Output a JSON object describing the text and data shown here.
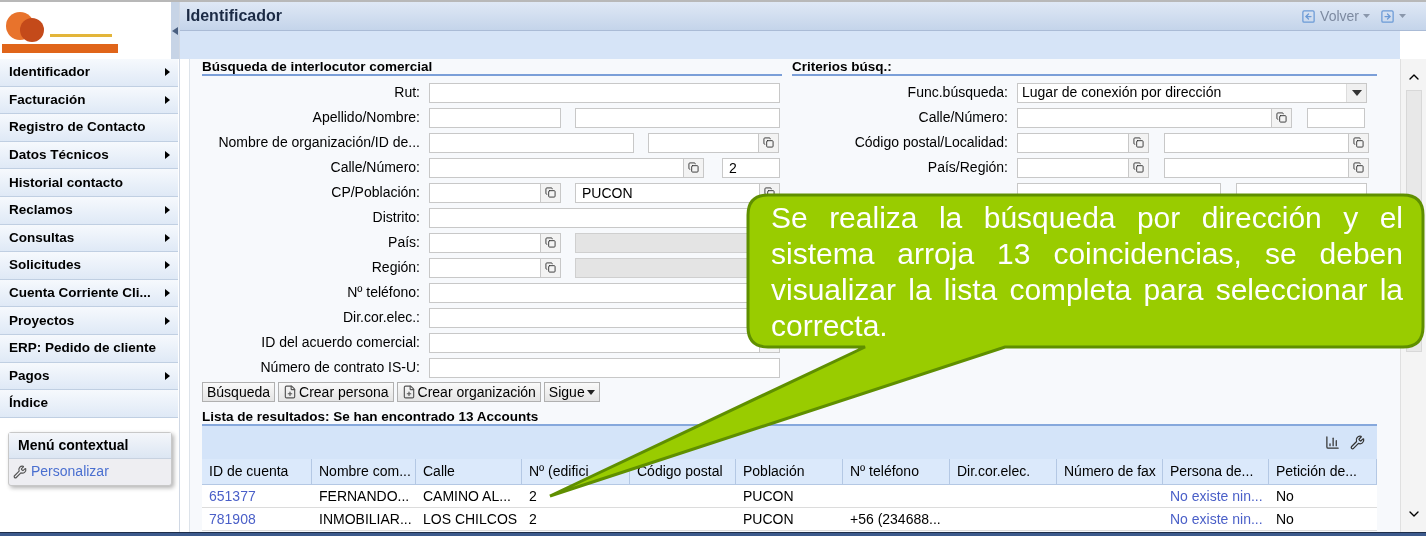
{
  "sidebar": {
    "items": [
      {
        "label": "Identificador",
        "has_submenu": true
      },
      {
        "label": "Facturación",
        "has_submenu": true
      },
      {
        "label": "Registro de Contacto",
        "has_submenu": false
      },
      {
        "label": "Datos Técnicos",
        "has_submenu": true
      },
      {
        "label": "Historial contacto",
        "has_submenu": false
      },
      {
        "label": "Reclamos",
        "has_submenu": true
      },
      {
        "label": "Consultas",
        "has_submenu": true
      },
      {
        "label": "Solicitudes",
        "has_submenu": true
      },
      {
        "label": "Cuenta Corriente Cli...",
        "has_submenu": true
      },
      {
        "label": "Proyectos",
        "has_submenu": true
      },
      {
        "label": "ERP: Pedido de cliente",
        "has_submenu": false
      },
      {
        "label": "Pagos",
        "has_submenu": true
      },
      {
        "label": "Índice",
        "has_submenu": false
      }
    ],
    "context_menu": {
      "title": "Menú contextual",
      "items": [
        {
          "label": "Personalizar"
        }
      ]
    }
  },
  "header": {
    "title": "Identificador",
    "back": {
      "label": "Volver",
      "disabled": true
    }
  },
  "search_form": {
    "title": "Búsqueda de interlocutor comercial",
    "fields": [
      {
        "label": "Rut:",
        "kind": "full",
        "inputs": [
          {
            "lookup": false,
            "disabled": false
          }
        ]
      },
      {
        "label": "Apellido/Nombre:",
        "kind": "pair",
        "inputs": [
          {
            "lookup": false,
            "disabled": false
          },
          {
            "lookup": false,
            "disabled": false
          }
        ]
      },
      {
        "label": "Nombre de organización/ID de...",
        "kind": "name_id",
        "inputs": [
          {
            "lookup": false,
            "disabled": false
          },
          {
            "lookup": true,
            "disabled": false
          }
        ]
      },
      {
        "label": "Calle/Número:",
        "kind": "street",
        "inputs": [
          {
            "lookup": true,
            "disabled": false
          },
          {
            "value": "2",
            "lookup": false,
            "disabled": false
          }
        ]
      },
      {
        "label": "CP/Población:",
        "kind": "pair",
        "inputs": [
          {
            "lookup": true,
            "disabled": false
          },
          {
            "value": "PUCON",
            "lookup": true,
            "disabled": false
          }
        ]
      },
      {
        "label": "Distrito:",
        "kind": "full",
        "inputs": [
          {
            "lookup": false,
            "disabled": false
          }
        ]
      },
      {
        "label": "País:",
        "kind": "pair",
        "inputs": [
          {
            "lookup": true,
            "disabled": false
          },
          {
            "lookup": false,
            "disabled": true
          }
        ]
      },
      {
        "label": "Región:",
        "kind": "pair",
        "inputs": [
          {
            "lookup": true,
            "disabled": false
          },
          {
            "lookup": false,
            "disabled": true
          }
        ]
      },
      {
        "label": "Nº teléfono:",
        "kind": "full",
        "inputs": [
          {
            "lookup": false,
            "disabled": false
          }
        ]
      },
      {
        "label": "Dir.cor.elec.:",
        "kind": "full",
        "inputs": [
          {
            "lookup": false,
            "disabled": false
          }
        ]
      },
      {
        "label": "ID del acuerdo comercial:",
        "kind": "full",
        "inputs": [
          {
            "lookup": true,
            "disabled": false
          }
        ]
      },
      {
        "label": "Número de contrato IS-U:",
        "kind": "full",
        "inputs": [
          {
            "lookup": false,
            "disabled": false
          }
        ]
      }
    ],
    "buttons": [
      {
        "label": "Búsqueda",
        "kind": "plain"
      },
      {
        "label": "Crear persona",
        "kind": "new"
      },
      {
        "label": "Crear organización",
        "kind": "new"
      },
      {
        "label": "Sigue",
        "kind": "menu"
      }
    ]
  },
  "criteria": {
    "title": "Criterios búsq.:",
    "fields": [
      {
        "label": "Func.búsqueda:",
        "kind": "select",
        "inputs": [
          {
            "value": "Lugar de conexión por dirección"
          }
        ]
      },
      {
        "label": "Calle/Número:",
        "kind": "street",
        "inputs": [
          {
            "lookup": true,
            "disabled": false
          },
          {
            "lookup": false,
            "disabled": false
          }
        ]
      },
      {
        "label": "Código postal/Localidad:",
        "kind": "pair",
        "inputs": [
          {
            "lookup": true,
            "disabled": false
          },
          {
            "lookup": true,
            "disabled": false
          }
        ]
      },
      {
        "label": "País/Región:",
        "kind": "pair",
        "inputs": [
          {
            "lookup": true,
            "disabled": false
          },
          {
            "lookup": true,
            "disabled": false
          }
        ]
      },
      {
        "kind": "wide_pair",
        "inputs": [
          {
            "lookup": false,
            "disabled": false
          },
          {
            "lookup": false,
            "disabled": false
          }
        ]
      }
    ]
  },
  "results": {
    "title": "Lista de resultados: Se han encontrado 13 Accounts",
    "columns": [
      "ID de cuenta",
      "Nombre com...",
      "Calle",
      "Nº (edifici",
      "Código postal",
      "Población",
      "Nº teléfono",
      "Dir.cor.elec.",
      "Número de fax",
      "Persona de...",
      "Petición de..."
    ],
    "rows": [
      [
        {
          "text": "651377",
          "link": true
        },
        {
          "text": "FERNANDO...",
          "link": false
        },
        {
          "text": "CAMINO AL...",
          "link": false
        },
        {
          "text": "2",
          "link": false
        },
        null,
        {
          "text": "PUCON",
          "link": false
        },
        null,
        null,
        null,
        {
          "text": "No existe nin...",
          "link": true
        },
        {
          "text": "No",
          "link": false
        }
      ],
      [
        {
          "text": "781908",
          "link": true
        },
        {
          "text": "INMOBILIAR...",
          "link": false
        },
        {
          "text": "LOS CHILCOS",
          "link": false
        },
        {
          "text": "2",
          "link": false
        },
        null,
        {
          "text": "PUCON",
          "link": false
        },
        {
          "text": "+56 (234688...",
          "link": false
        },
        null,
        null,
        {
          "text": "No existe nin...",
          "link": true
        },
        {
          "text": "No",
          "link": false
        }
      ]
    ]
  },
  "callout": {
    "text": "Se realiza la búsqueda por dirección y el sistema arroja 13 coincidencias, se deben visualizar la lista completa para seleccionar la correcta."
  }
}
